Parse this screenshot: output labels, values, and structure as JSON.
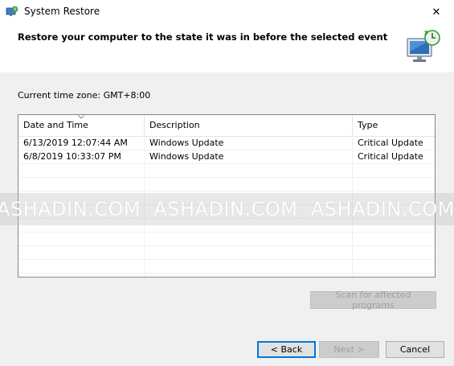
{
  "window": {
    "title": "System Restore",
    "close_glyph": "✕"
  },
  "header": {
    "heading": "Restore your computer to the state it was in before the selected event",
    "icon": "system-restore-monitor-icon"
  },
  "timezone_label": "Current time zone: GMT+8:00",
  "table": {
    "columns": [
      "Date and Time",
      "Description",
      "Type"
    ],
    "rows": [
      {
        "date": "6/13/2019 12:07:44 AM",
        "description": "Windows Update",
        "type": "Critical Update"
      },
      {
        "date": "6/8/2019 10:33:07 PM",
        "description": "Windows Update",
        "type": "Critical Update"
      }
    ]
  },
  "watermark": "ASHADIN.COM  ASHADIN.COM  ASHADIN.COM",
  "buttons": {
    "scan": "Scan for affected programs",
    "back": "< Back",
    "next": "Next >",
    "cancel": "Cancel"
  },
  "colors": {
    "accent": "#0078d7",
    "disabled_text": "#a0a0a0"
  }
}
